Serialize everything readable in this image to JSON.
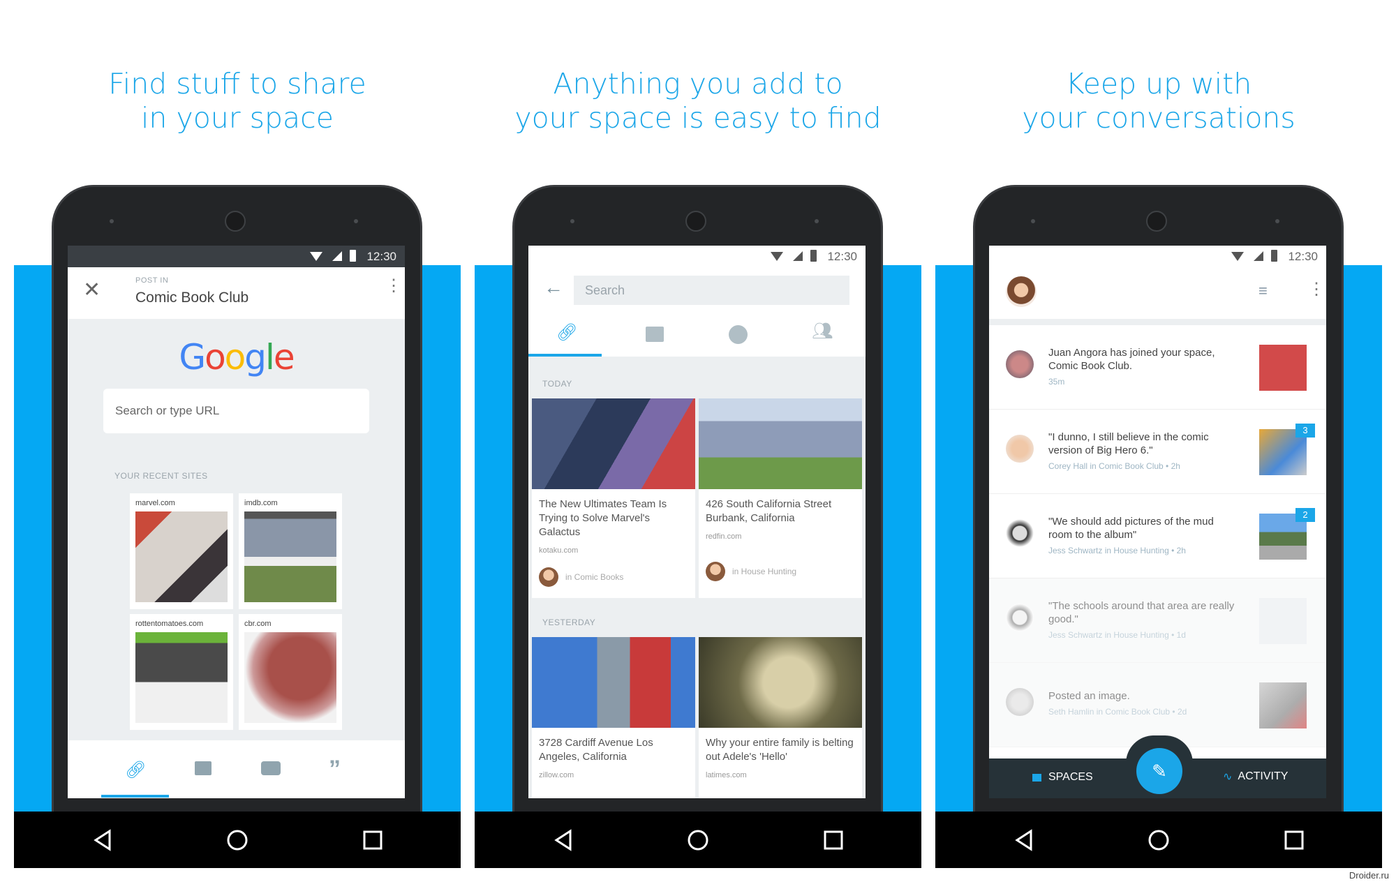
{
  "headlines": [
    {
      "line1": "Find stuff to share",
      "line2": "in your space"
    },
    {
      "line1": "Anything you add to",
      "line2": "your space is easy to find"
    },
    {
      "line1": "Keep up with",
      "line2": "your conversations"
    }
  ],
  "status_time": "12:30",
  "screen1": {
    "post_in_label": "POST IN",
    "space_title": "Comic Book Club",
    "logo": "Google",
    "search_placeholder": "Search or type URL",
    "recent_label": "YOUR RECENT SITES",
    "sites": [
      "marvel.com",
      "imdb.com",
      "rottentomatoes.com",
      "cbr.com"
    ],
    "bottom_tabs": [
      "link-icon",
      "image-icon",
      "video-icon",
      "quote-icon"
    ],
    "active_tab": 0
  },
  "screen2": {
    "search_placeholder": "Search",
    "tabs": [
      "link-icon",
      "image-icon",
      "video-icon",
      "people-icon"
    ],
    "active_tab": 0,
    "today_label": "TODAY",
    "yesterday_label": "YESTERDAY",
    "today_cards": [
      {
        "title": "The New Ultimates Team Is Trying to Solve Marvel's Galactus",
        "source": "kotaku.com",
        "space": "in Comic Books"
      },
      {
        "title": "426 South California Street Burbank, California",
        "source": "redfin.com",
        "space": "in House Hunting"
      }
    ],
    "yesterday_cards": [
      {
        "title": "3728 Cardiff Avenue Los Angeles, California",
        "source": "zillow.com"
      },
      {
        "title": "Why your entire family is belting out Adele's 'Hello'",
        "source": "latimes.com"
      }
    ]
  },
  "screen3": {
    "items": [
      {
        "text": "Juan Angora has joined your space, Comic Book Club.",
        "meta": "35m",
        "badge": ""
      },
      {
        "text": "\"I dunno, I still believe in the comic version of Big Hero 6.\"",
        "meta": "Corey Hall in Comic Book Club • 2h",
        "badge": "3"
      },
      {
        "text": "\"We should add pictures of the mud room to the album\"",
        "meta": "Jess Schwartz in House Hunting • 2h",
        "badge": "2"
      },
      {
        "text": "\"The schools around that area are really good.\"",
        "meta": "Jess Schwartz in House Hunting • 1d",
        "badge": ""
      },
      {
        "text": "Posted an image.",
        "meta": "Seth Hamlin in Comic Book Club • 2d",
        "badge": ""
      }
    ],
    "spaces_label": "SPACES",
    "activity_label": "ACTIVITY"
  },
  "watermark": "Droider.ru",
  "colors": {
    "accent": "#1ba6e8",
    "band": "#05a8f3",
    "dark_bar": "#263238"
  }
}
